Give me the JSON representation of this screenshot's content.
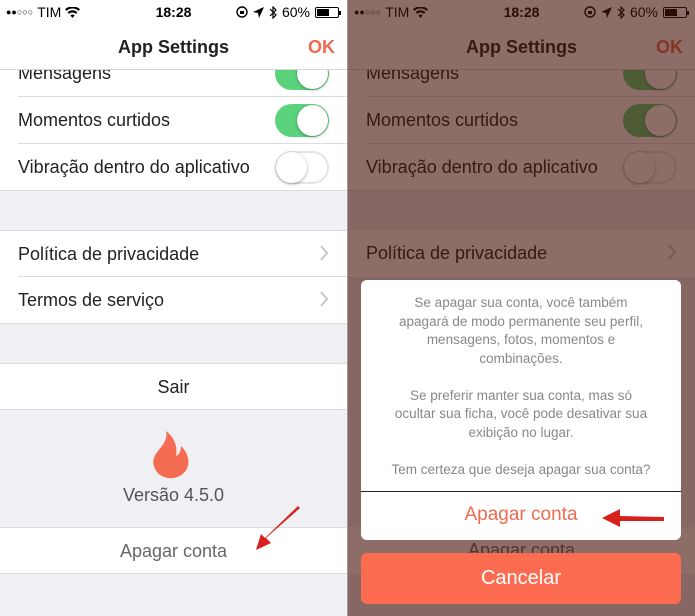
{
  "status": {
    "carrier": "TIM",
    "time": "18:28",
    "battery_text": "60%",
    "battery_level": 0.6
  },
  "navbar": {
    "title": "App Settings",
    "ok_label": "OK"
  },
  "settings": {
    "mensagens_label": "Mensagens",
    "momentos_label": "Momentos curtidos",
    "vibracao_label": "Vibração dentro do aplicativo",
    "mensagens_on": true,
    "momentos_on": true,
    "vibracao_on": false
  },
  "legal": {
    "privacy_label": "Política de privacidade",
    "terms_label": "Termos de serviço"
  },
  "logout_label": "Sair",
  "version_text": "Versão 4.5.0",
  "delete_account_label": "Apagar conta",
  "action_sheet": {
    "message": "Se apagar sua conta, você também\napagará de modo permanente seu perfil,\nmensagens, fotos, momentos e\ncombinações.\n\nSe preferir manter sua conta, mas só\nocultar sua ficha, você pode desativar sua\nexibição no lugar.\n\nTem certeza que deseja apagar sua conta?",
    "confirm_label": "Apagar conta",
    "cancel_label": "Cancelar"
  },
  "colors": {
    "accent": "#f06a4f",
    "toggle_on": "#5bd37d",
    "cancel_bg": "#fd6b50",
    "arrow": "#d8201c"
  }
}
